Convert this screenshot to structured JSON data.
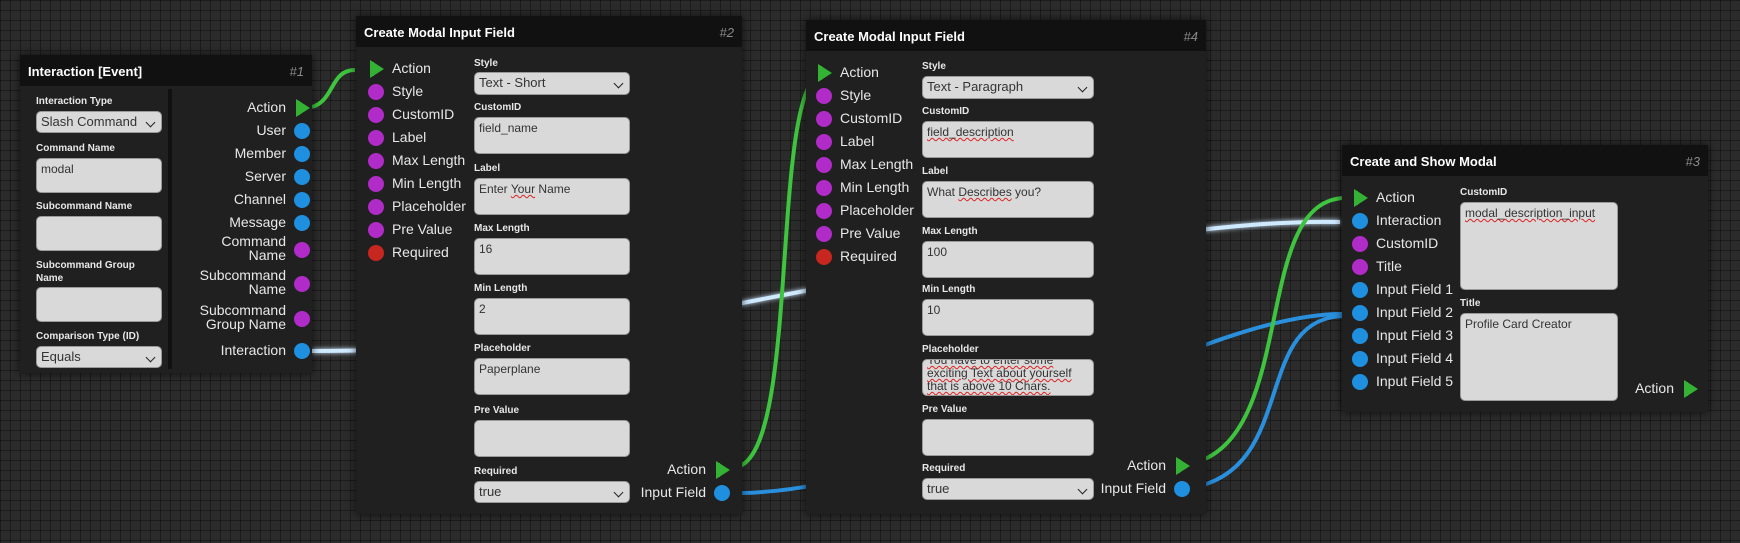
{
  "nodes": {
    "interaction": {
      "title": "Interaction [Event]",
      "id": "#1",
      "fields": {
        "interaction_type_label": "Interaction Type",
        "interaction_type_value": "Slash Command",
        "command_name_label": "Command Name",
        "command_name_value": "modal",
        "subcommand_name_label": "Subcommand Name",
        "subcommand_name_value": "",
        "subcommand_group_label_1": "Subcommand Group",
        "subcommand_group_label_2": "Name",
        "subcommand_group_value": "",
        "comparison_type_label": "Comparison Type (ID)",
        "comparison_type_value": "Equals"
      },
      "outputs": {
        "action": "Action",
        "user": "User",
        "member": "Member",
        "server": "Server",
        "channel": "Channel",
        "message": "Message",
        "command_name_1": "Command",
        "command_name_2": "Name",
        "subcommand_name_1": "Subcommand",
        "subcommand_name_2": "Name",
        "subcommand_group_1": "Subcommand",
        "subcommand_group_2": "Group Name",
        "interaction": "Interaction"
      }
    },
    "modal_input_2": {
      "title": "Create Modal Input Field",
      "id": "#2",
      "inputs": {
        "action": "Action",
        "style": "Style",
        "customid": "CustomID",
        "label": "Label",
        "max_length": "Max Length",
        "min_length": "Min Length",
        "placeholder": "Placeholder",
        "pre_value": "Pre Value",
        "required": "Required"
      },
      "fields": {
        "style_label": "Style",
        "style_value": "Text - Short",
        "customid_label": "CustomID",
        "customid_value": "field_name",
        "label_label": "Label",
        "label_value_1": "Enter ",
        "label_value_2": "Your",
        "label_value_3": " Name",
        "max_length_label": "Max Length",
        "max_length_value": "16",
        "min_length_label": "Min Length",
        "min_length_value": "2",
        "placeholder_label": "Placeholder",
        "placeholder_value": "Paperplane",
        "pre_value_label": "Pre Value",
        "pre_value_value": "",
        "required_label": "Required",
        "required_value": "true"
      },
      "outputs": {
        "action": "Action",
        "input_field": "Input Field"
      }
    },
    "modal_input_4": {
      "title": "Create Modal Input Field",
      "id": "#4",
      "inputs": {
        "action": "Action",
        "style": "Style",
        "customid": "CustomID",
        "label": "Label",
        "max_length": "Max Length",
        "min_length": "Min Length",
        "placeholder": "Placeholder",
        "pre_value": "Pre Value",
        "required": "Required"
      },
      "fields": {
        "style_label": "Style",
        "style_value": "Text - Paragraph",
        "customid_label": "CustomID",
        "customid_value": "field_description",
        "label_label": "Label",
        "label_value_1": "What ",
        "label_value_2": "Describes",
        "label_value_3": " you?",
        "max_length_label": "Max Length",
        "max_length_value": "100",
        "min_length_label": "Min Length",
        "min_length_value": "10",
        "placeholder_label": "Placeholder",
        "placeholder_line_1": "You have to enter some",
        "placeholder_line_2": "exciting Text about yourself",
        "placeholder_line_3": "that is above 10 Chars.",
        "pre_value_label": "Pre Value",
        "pre_value_value": "",
        "required_label": "Required",
        "required_value": "true"
      },
      "outputs": {
        "action": "Action",
        "input_field": "Input Field"
      }
    },
    "show_modal": {
      "title": "Create and Show Modal",
      "id": "#3",
      "inputs": {
        "action": "Action",
        "interaction": "Interaction",
        "customid": "CustomID",
        "title": "Title",
        "input_field_1": "Input Field 1",
        "input_field_2": "Input Field 2",
        "input_field_3": "Input Field 3",
        "input_field_4": "Input Field 4",
        "input_field_5": "Input Field 5"
      },
      "fields": {
        "customid_label": "CustomID",
        "customid_value": "modal_description_input",
        "title_label": "Title",
        "title_value": "Profile Card Creator"
      },
      "outputs": {
        "action": "Action"
      }
    }
  },
  "colors": {
    "action_port": "#33b233",
    "object_port": "#1f8fe0",
    "text_port": "#b02bc7",
    "boolean_port": "#c7271e",
    "action_wire": "#3ec43e",
    "object_wire": "#2a8fdc"
  }
}
